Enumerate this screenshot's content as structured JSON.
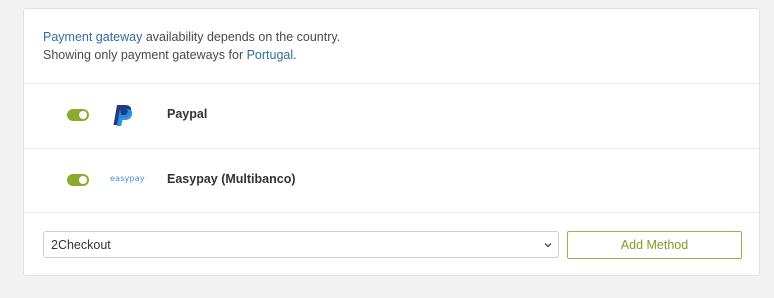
{
  "notice": {
    "link_text": "Payment gateway",
    "line1_rest": " availability depends on the country.",
    "line2_prefix": "Showing only payment gateways for ",
    "country": "Portugal",
    "line2_suffix": "."
  },
  "gateways": [
    {
      "name": "Paypal",
      "enabled": true,
      "icon": "paypal-logo-icon"
    },
    {
      "name": "Easypay (Multibanco)",
      "enabled": true,
      "icon": "easypay-logo",
      "logo_text": "easypay"
    }
  ],
  "add_form": {
    "selected_method": "2Checkout",
    "add_button_label": "Add Method"
  },
  "colors": {
    "accent": "#8bab2f",
    "link": "#2f6fa0",
    "button_text": "#7e9c2b"
  }
}
